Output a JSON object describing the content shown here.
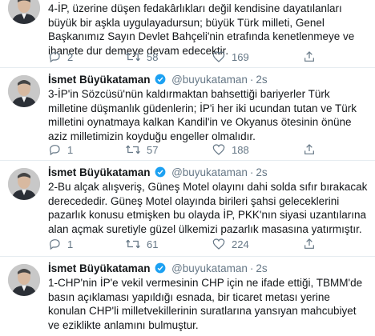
{
  "tweets": [
    {
      "name": "",
      "handle": "",
      "time": "",
      "text": "4-İP, üzerine düşen fedakârlıkları değil kendisine dayatılanları büyük bir aşkla uygulayadursun; büyük Türk milleti, Genel Başkanımız Sayın Devlet Bahçeli'nin etrafında kenetlenmeye ve ihanete dur demeye devam edecektir.",
      "replies": "2",
      "retweets": "58",
      "likes": "169"
    },
    {
      "name": "İsmet Büyükataman",
      "handle": "@buyukataman",
      "time": "2s",
      "text": "3-İP'in Sözcüsü'nün kaldırmaktan bahsettiği bariyerler Türk milletine düşmanlık güdenlerin; İP'i her iki ucundan tutan ve Türk milletini oynatmaya kalkan Kandil'in ve Okyanus ötesinin önüne aziz milletimizin koyduğu engeller olmalıdır.",
      "replies": "1",
      "retweets": "57",
      "likes": "188"
    },
    {
      "name": "İsmet Büyükataman",
      "handle": "@buyukataman",
      "time": "2s",
      "text": "2-Bu alçak alışveriş, Güneş Motel olayını dahi solda sıfır bırakacak derecededir. Güneş Motel olayında birileri şahsi geleceklerini pazarlık konusu etmişken bu olayda İP, PKK'nın siyasi uzantılarına alan açmak suretiyle güzel ülkemizi pazarlık masasına yatırmıştır.",
      "replies": "1",
      "retweets": "61",
      "likes": "224"
    },
    {
      "name": "İsmet Büyükataman",
      "handle": "@buyukataman",
      "time": "2s",
      "text": "1-CHP'nin İP'e vekil vermesinin CHP için ne ifade ettiği, TBMM'de basın açıklaması yapıldığı esnada, bir ticaret metası yerine konulan CHP'li milletvekillerinin suratlarına yansıyan mahcubiyet ve eziklikte anlamını bulmuştur.",
      "replies": "",
      "retweets": "",
      "likes": ""
    }
  ],
  "icons": {
    "reply": "reply-icon",
    "retweet": "retweet-icon",
    "like": "heart-icon",
    "verified": "verified-badge-icon"
  },
  "colors": {
    "text": "#14171a",
    "muted": "#657786",
    "verified": "#1da1f2",
    "divider": "#e6ecf0"
  }
}
